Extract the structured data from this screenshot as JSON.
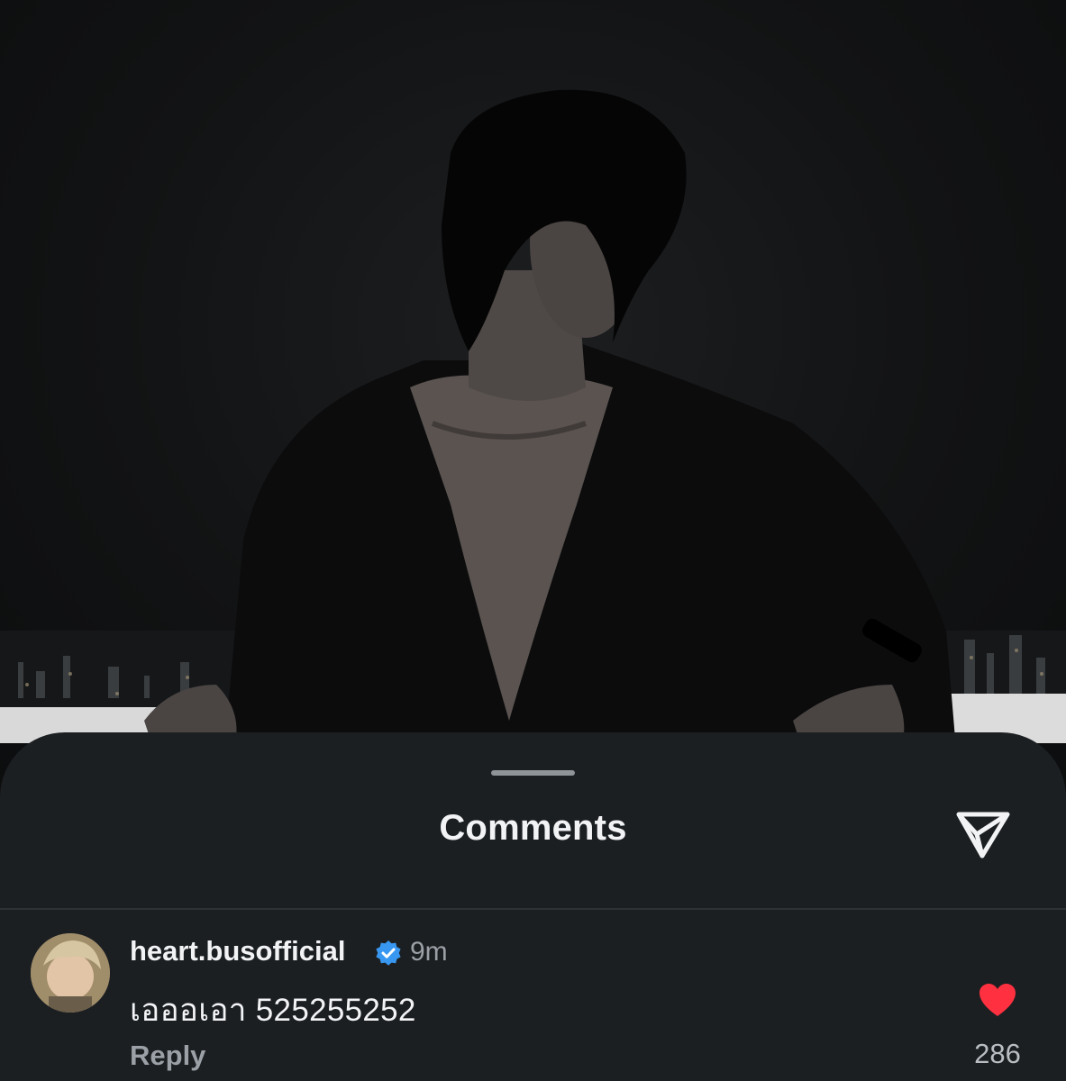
{
  "sheet": {
    "title": "Comments",
    "share_icon": "send-paper-plane-icon"
  },
  "comments": [
    {
      "username": "heart.busofficial",
      "verified": true,
      "verified_icon": "verified-badge-icon",
      "time": "9m",
      "text": "เอออเอา 525255252",
      "reply_label": "Reply",
      "like_icon": "heart-filled-icon",
      "like_count": "286"
    }
  ],
  "colors": {
    "sheet_background": "#1c1f22",
    "text_primary": "#f2f3f5",
    "text_secondary": "#9aa0a6",
    "verified_blue": "#3897f0",
    "like_red": "#ff3040"
  }
}
